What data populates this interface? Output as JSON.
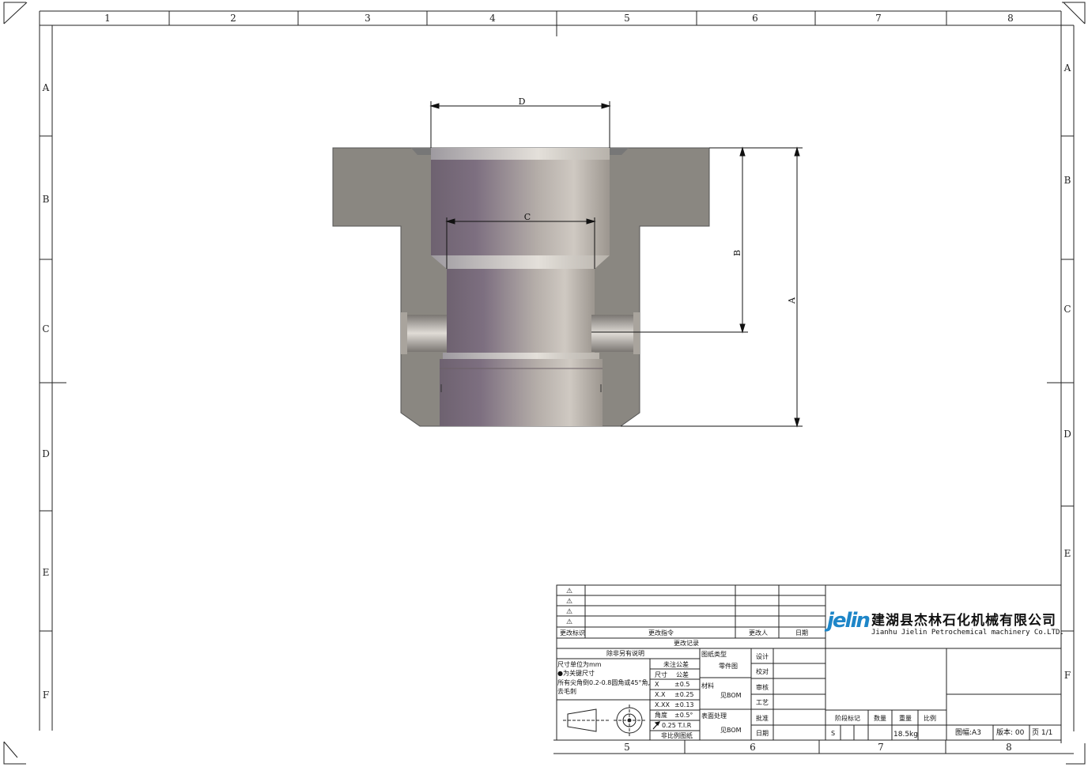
{
  "border": {
    "columns_top": [
      "1",
      "2",
      "3",
      "4",
      "5",
      "6",
      "7",
      "8"
    ],
    "rows_side": [
      "A",
      "B",
      "C",
      "D",
      "E",
      "F"
    ],
    "columns_bottom": [
      "5",
      "6",
      "7",
      "8"
    ]
  },
  "dimensions": {
    "a": "A",
    "b": "B",
    "c": "C",
    "d": "D"
  },
  "revision_table": {
    "triangle": "⚠",
    "col_mark": "更改标识",
    "col_order": "更改指令",
    "col_person": "更改人",
    "col_date": "日期",
    "title": "更改记录"
  },
  "notes": {
    "header": "除非另有说明",
    "line1": "尺寸单位为mm",
    "line2": "●为关键尺寸",
    "line3": "所有尖角倒0.2-0.8圆角或45°角,",
    "line4": "去毛刺"
  },
  "tolerance": {
    "header": "未注公差",
    "col_size": "尺寸",
    "col_tol": "公差",
    "r1_size": "X",
    "r1_tol": "±0.5",
    "r2_size": "X.X",
    "r2_tol": "±0.25",
    "r3_size": "X.XX",
    "r3_tol": "±0.13",
    "r4_size": "角度",
    "r4_tol": "±0.5°",
    "runout": "0.25 T.I.R",
    "scale_note": "非比例图纸"
  },
  "drawing_info": {
    "type_label": "图纸类型",
    "type_value": "零件图",
    "material_label": "材料",
    "material_value": "见BOM",
    "surface_label": "表面处理",
    "surface_value": "见BOM"
  },
  "approval": {
    "design": "设计",
    "check": "校对",
    "review": "审核",
    "process": "工艺",
    "approve": "批准",
    "date": "日期"
  },
  "company": {
    "logo": "jelin",
    "name_cn": "建湖县杰林石化机械有限公司",
    "name_en": "Jianhu Jielin Petrochemical machinery Co.LTD."
  },
  "stage": {
    "stage_label": "阶段标记",
    "qty_label": "数量",
    "weight_label": "重量",
    "scale_label": "比例",
    "stage_value": "S",
    "weight_value": "18.5kg"
  },
  "sheet_info": {
    "size": "图幅:A3",
    "version": "版本: 00",
    "page": "页 1/1"
  },
  "colors": {
    "metal": "#8a8781",
    "bore": "#8a7a8e",
    "line": "#111111",
    "logo": "#1e86c8"
  }
}
